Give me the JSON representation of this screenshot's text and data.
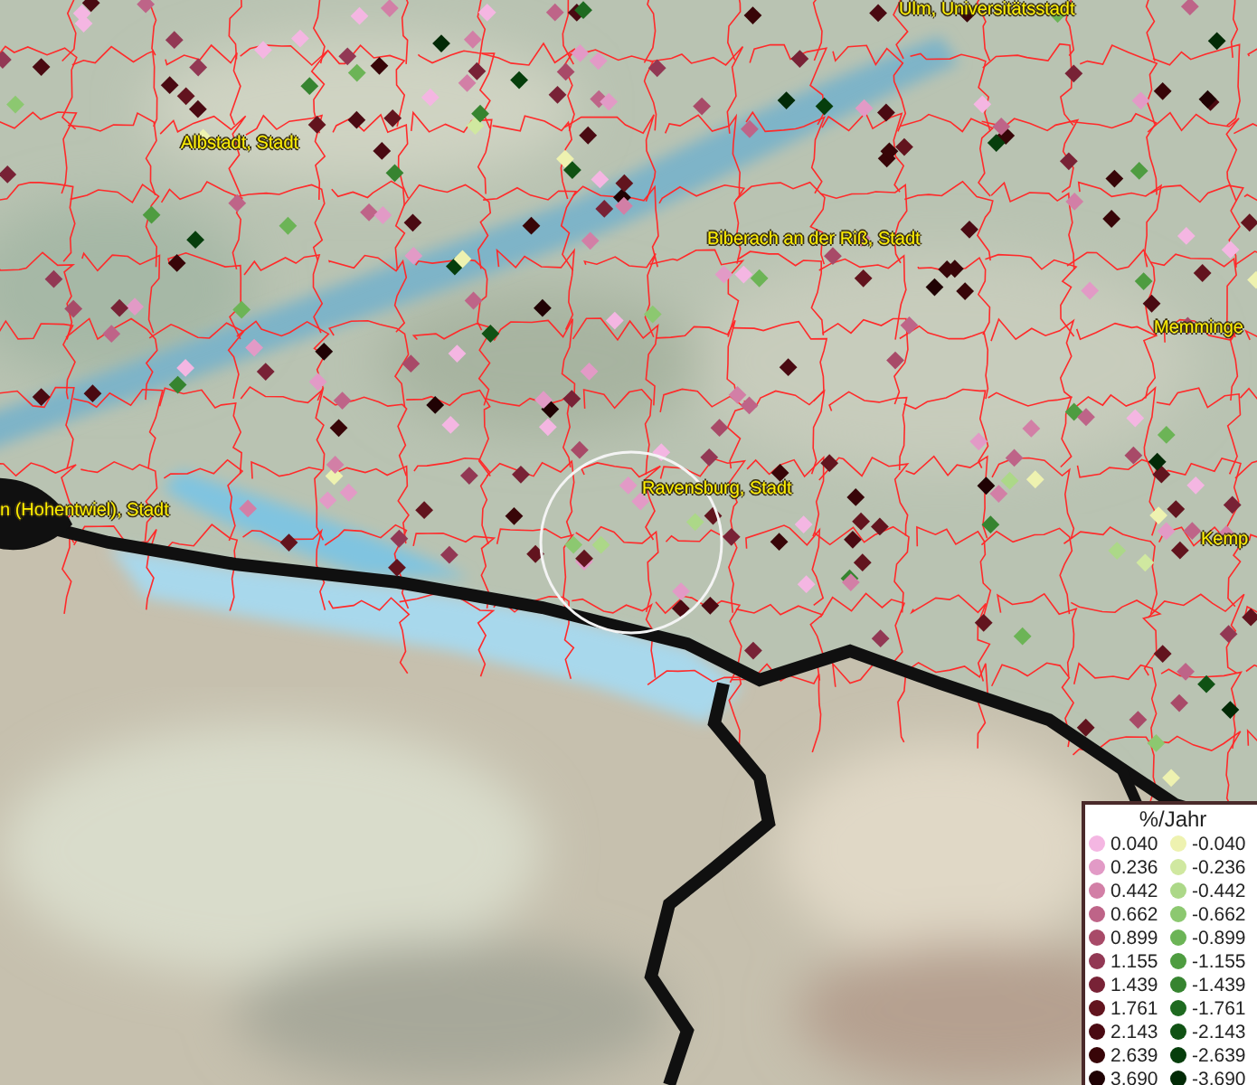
{
  "map": {
    "places": [
      {
        "label": "Ulm, Universitätsstadt"
      },
      {
        "label": "Albstadt, Stadt"
      },
      {
        "label": "Biberach an der Riß, Stadt"
      },
      {
        "label": "Memminge"
      },
      {
        "label": "Ravensburg, Stadt"
      },
      {
        "label": "n (Hohentwiel), Stadt"
      },
      {
        "label": "Kemp"
      }
    ]
  },
  "legend": {
    "title": "%/Jahr",
    "rows": [
      {
        "positive": {
          "value": "0.040",
          "color": "#f4b6e2"
        },
        "negative": {
          "value": "-0.040",
          "color": "#eef2b0"
        }
      },
      {
        "positive": {
          "value": "0.236",
          "color": "#e29ac6"
        },
        "negative": {
          "value": "-0.236",
          "color": "#d0e8a0"
        }
      },
      {
        "positive": {
          "value": "0.442",
          "color": "#d27fa6"
        },
        "negative": {
          "value": "-0.442",
          "color": "#acd888"
        }
      },
      {
        "positive": {
          "value": "0.662",
          "color": "#be6488"
        },
        "negative": {
          "value": "-0.662",
          "color": "#8cc870"
        }
      },
      {
        "positive": {
          "value": "0.899",
          "color": "#a84a68"
        },
        "negative": {
          "value": "-0.899",
          "color": "#6cb456"
        }
      },
      {
        "positive": {
          "value": "1.155",
          "color": "#923854"
        },
        "negative": {
          "value": "-1.155",
          "color": "#4e9c40"
        }
      },
      {
        "positive": {
          "value": "1.439",
          "color": "#782236"
        },
        "negative": {
          "value": "-1.439",
          "color": "#368430"
        }
      },
      {
        "positive": {
          "value": "1.761",
          "color": "#62141e"
        },
        "negative": {
          "value": "-1.761",
          "color": "#1e6a20"
        }
      },
      {
        "positive": {
          "value": "2.143",
          "color": "#4a0a12"
        },
        "negative": {
          "value": "-2.143",
          "color": "#105214"
        }
      },
      {
        "positive": {
          "value": "2.639",
          "color": "#380508"
        },
        "negative": {
          "value": "-2.639",
          "color": "#063e0c"
        }
      },
      {
        "positive": {
          "value": "3.690",
          "color": "#200204"
        },
        "negative": {
          "value": "-3.690",
          "color": "#022a06"
        }
      }
    ]
  }
}
